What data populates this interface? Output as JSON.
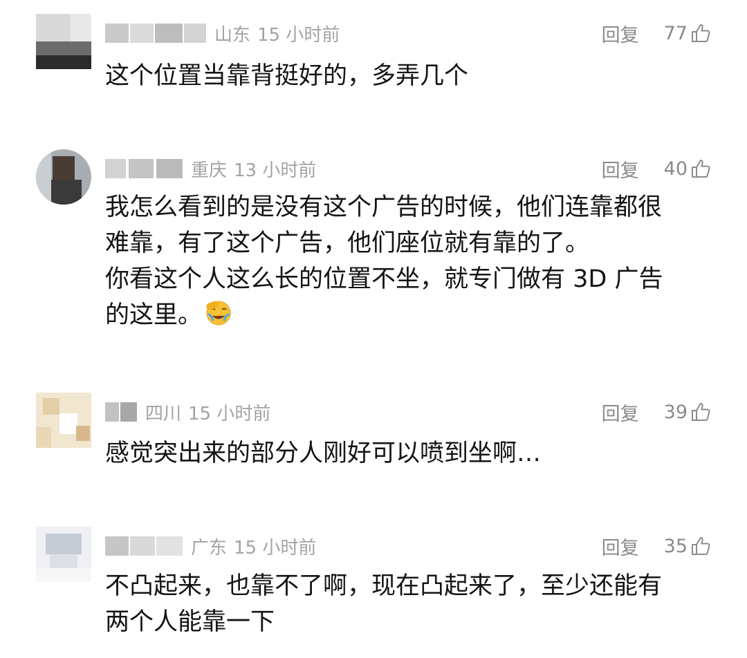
{
  "comments": [
    {
      "location": "山东",
      "time": "15 小时前",
      "reply_label": "回复",
      "likes": "77",
      "lines": [
        "这个位置当靠背挺好的，多弄几个"
      ]
    },
    {
      "location": "重庆",
      "time": "13 小时前",
      "reply_label": "回复",
      "likes": "40",
      "lines": [
        "我怎么看到的是没有这个广告的时候，他们连靠都很",
        "难靠，有了这个广告，他们座位就有靠的了。",
        "你看这个人这么长的位置不坐，就专门做有 3D 广告",
        "的这里。"
      ],
      "emoji": "facepalm-laughing-emoji"
    },
    {
      "location": "四川",
      "time": "15 小时前",
      "reply_label": "回复",
      "likes": "39",
      "lines": [
        "感觉突出来的部分人刚好可以喷到坐啊…"
      ]
    },
    {
      "location": "广东",
      "time": "15 小时前",
      "reply_label": "回复",
      "likes": "35",
      "lines": [
        "不凸起来，也靠不了啊，现在凸起来了，至少还能有",
        "两个人能靠一下"
      ]
    }
  ],
  "icons": {
    "like": "thumbs-up-icon",
    "avatar": "blurred-avatar"
  },
  "colors": {
    "meta_text": "#a3a3a3",
    "action_text": "#8a8a8a",
    "body_text": "#141414"
  }
}
